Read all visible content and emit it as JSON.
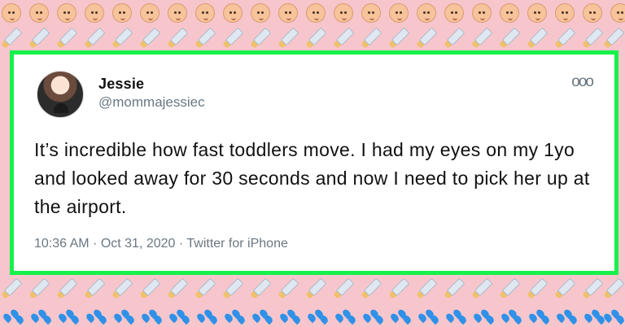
{
  "background": {
    "color": "#f7c6cc",
    "icons": [
      "baby-face-icon",
      "baby-bottle-icon",
      "sweat-droplets-icon"
    ]
  },
  "tweet": {
    "author_name": "Jessie",
    "author_handle": "@mommajessiec",
    "more_icon": "more-options-icon",
    "more_label": "ooo",
    "text": "It’s incredible how fast toddlers move. I had my eyes on my 1yo and looked away for 30 seconds and now I need to pick her up at the airport.",
    "meta": "10:36 AM · Oct 31, 2020 · Twitter for iPhone"
  },
  "card": {
    "border_color": "#16f24b"
  }
}
